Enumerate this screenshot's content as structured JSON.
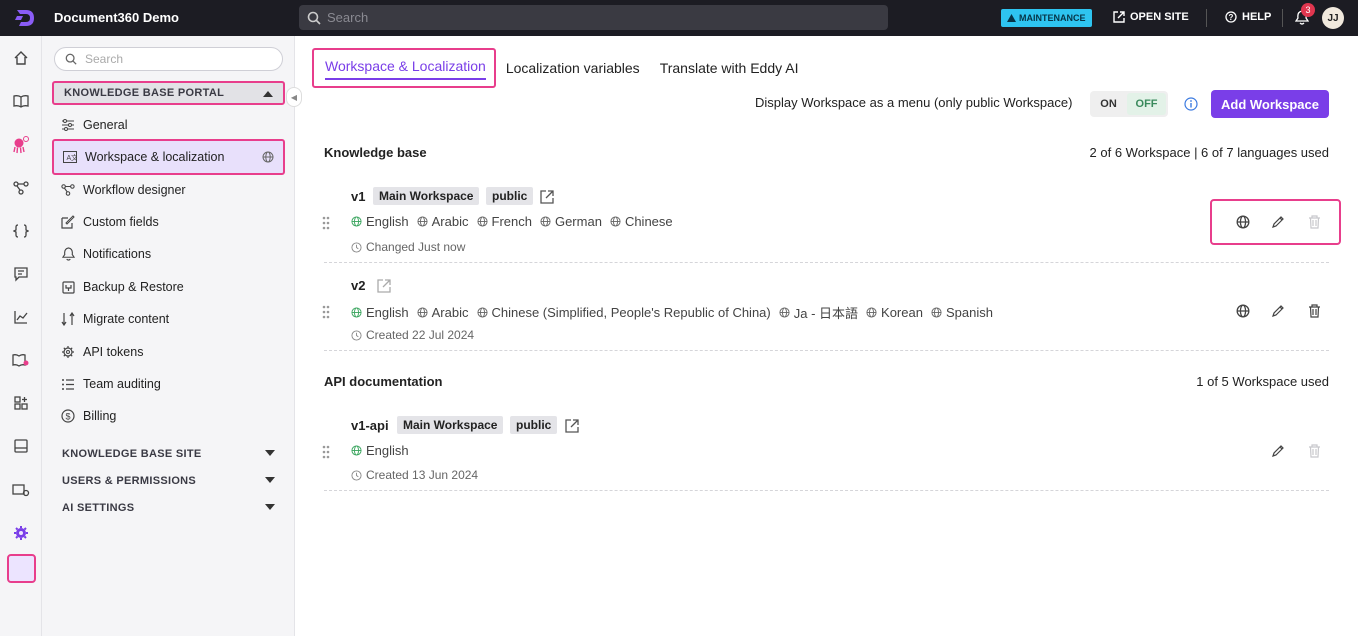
{
  "header": {
    "app_title": "Document360 Demo",
    "search_placeholder": "Search",
    "maintenance_label": "MAINTENANCE",
    "open_site_label": "OPEN SITE",
    "help_label": "HELP",
    "notification_count": "3",
    "avatar_initials": "JJ"
  },
  "rail": {
    "icons": [
      "home-icon",
      "book-icon",
      "octopus-icon",
      "workflow-icon",
      "code-braces-icon",
      "chat-icon",
      "analytics-icon",
      "kb-site-icon",
      "widgets-icon",
      "drive-icon",
      "settings-display-icon",
      "settings-icon"
    ]
  },
  "sidebar": {
    "search_placeholder": "Search",
    "sections": {
      "kb_portal": "KNOWLEDGE BASE PORTAL",
      "kb_site": "KNOWLEDGE BASE SITE",
      "users": "USERS & PERMISSIONS",
      "ai": "AI SETTINGS"
    },
    "items": [
      {
        "label": "General",
        "icon": "sliders-icon"
      },
      {
        "label": "Workspace & localization",
        "icon": "translate-icon"
      },
      {
        "label": "Workflow designer",
        "icon": "workflow-icon"
      },
      {
        "label": "Custom fields",
        "icon": "edit-field-icon"
      },
      {
        "label": "Notifications",
        "icon": "bell-icon"
      },
      {
        "label": "Backup & Restore",
        "icon": "backup-icon"
      },
      {
        "label": "Migrate content",
        "icon": "migrate-icon"
      },
      {
        "label": "API tokens",
        "icon": "gear-key-icon"
      },
      {
        "label": "Team auditing",
        "icon": "list-icon"
      },
      {
        "label": "Billing",
        "icon": "dollar-icon"
      }
    ]
  },
  "main": {
    "tabs": [
      "Workspace & Localization",
      "Localization variables",
      "Translate with Eddy AI"
    ],
    "display_label": "Display Workspace as a menu (only public Workspace)",
    "toggle_on": "ON",
    "toggle_off": "OFF",
    "add_workspace": "Add Workspace",
    "kb": {
      "title": "Knowledge base",
      "usage": "2 of 6 Workspace | 6 of 7 languages used",
      "workspaces": [
        {
          "name": "v1",
          "tags": [
            "Main Workspace",
            "public"
          ],
          "languages": [
            "English",
            "Arabic",
            "French",
            "German",
            "Chinese"
          ],
          "meta": "Changed Just now"
        },
        {
          "name": "v2",
          "tags": [],
          "languages": [
            "English",
            "Arabic",
            "Chinese (Simplified, People's Republic of China)",
            "Ja - 日本語",
            "Korean",
            "Spanish"
          ],
          "meta": "Created 22 Jul 2024"
        }
      ]
    },
    "api": {
      "title": "API documentation",
      "usage": "1 of 5 Workspace used",
      "workspaces": [
        {
          "name": "v1-api",
          "tags": [
            "Main Workspace",
            "public"
          ],
          "languages": [
            "English"
          ],
          "meta": "Created 13 Jun 2024"
        }
      ]
    }
  },
  "colors": {
    "accent": "#7a3ee8",
    "highlight": "#e83e8c",
    "topbar": "#1c1c23",
    "maintenance": "#2ec4f0"
  }
}
